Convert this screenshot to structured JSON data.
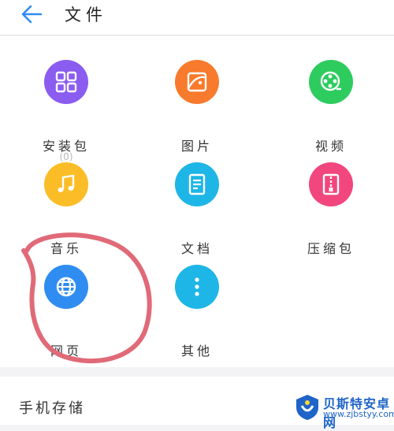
{
  "header": {
    "title": "文件"
  },
  "categories": [
    {
      "label": "安装包",
      "count": "(0)",
      "icon": "apps-grid-icon",
      "color": "#8a5cf0"
    },
    {
      "label": "图片",
      "count": "",
      "icon": "image-icon",
      "color": "#f87a2c"
    },
    {
      "label": "视频",
      "count": "",
      "icon": "film-reel-icon",
      "color": "#2ecc5f"
    },
    {
      "label": "音乐",
      "count": "",
      "icon": "music-note-icon",
      "color": "#fbbd27"
    },
    {
      "label": "文档",
      "count": "",
      "icon": "document-icon",
      "color": "#1eb6e6"
    },
    {
      "label": "压缩包",
      "count": "",
      "icon": "archive-icon",
      "color": "#f2467e"
    },
    {
      "label": "网页",
      "count": "",
      "icon": "globe-icon",
      "color": "#2f8df2"
    },
    {
      "label": "其他",
      "count": "",
      "icon": "more-dots-icon",
      "color": "#1eb6e6"
    }
  ],
  "storage": {
    "label": "手机存储"
  },
  "watermark": {
    "name": "贝斯特安卓网",
    "url": "www.zjbstyy.com"
  },
  "annotation": {
    "color": "#e06a78"
  }
}
